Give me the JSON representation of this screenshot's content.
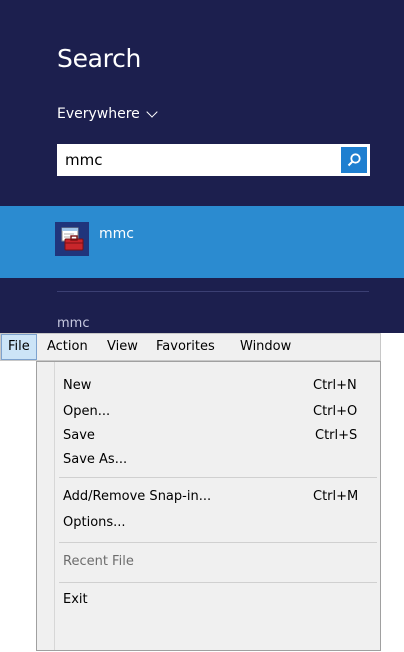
{
  "search": {
    "title": "Search",
    "scope": "Everywhere",
    "query": "mmc",
    "result_label": "mmc",
    "section_label": "mmc"
  },
  "menubar": {
    "items": [
      "File",
      "Action",
      "View",
      "Favorites",
      "Window"
    ]
  },
  "file_menu": {
    "new": "New",
    "new_sc": "Ctrl+N",
    "open": "Open...",
    "open_sc": "Ctrl+O",
    "save": "Save",
    "save_sc": "Ctrl+S",
    "save_as": "Save As...",
    "snapin": "Add/Remove Snap-in...",
    "snapin_sc": "Ctrl+M",
    "options": "Options...",
    "recent": "Recent File",
    "exit": "Exit"
  },
  "colors": {
    "search_bg": "#1c1f4e",
    "highlight": "#2b8bd0",
    "search_button": "#1e7fd0"
  },
  "icons": {
    "search": "magnifier-icon",
    "app": "toolbox-icon",
    "scope": "chevron-down-icon"
  }
}
